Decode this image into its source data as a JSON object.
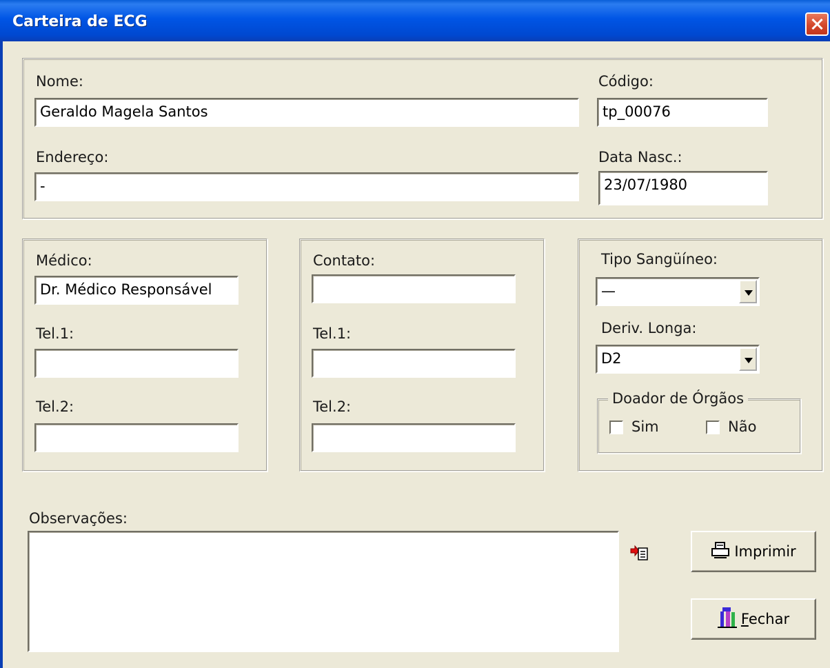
{
  "window": {
    "title": "Carteira de ECG"
  },
  "patient": {
    "name_label": "Nome:",
    "name_value": "Geraldo Magela Santos",
    "code_label": "Código:",
    "code_value": "tp_00076",
    "address_label": "Endereço:",
    "address_value": "-",
    "birth_label": "Data Nasc.:",
    "birth_value": "23/07/1980"
  },
  "doctor": {
    "label": "Médico:",
    "value": "Dr. Médico Responsável",
    "tel1_label": "Tel.1:",
    "tel1_value": "",
    "tel2_label": "Tel.2:",
    "tel2_value": ""
  },
  "contact": {
    "label": "Contato:",
    "value": "",
    "tel1_label": "Tel.1:",
    "tel1_value": "",
    "tel2_label": "Tel.2:",
    "tel2_value": ""
  },
  "medical": {
    "blood_label": "Tipo Sangüíneo:",
    "blood_value": "—",
    "lead_label": "Deriv. Longa:",
    "lead_value": "D2",
    "donor_legend": "Doador de Órgãos",
    "donor_yes": "Sim",
    "donor_no": "Não"
  },
  "notes": {
    "label": "Observações:",
    "value": ""
  },
  "buttons": {
    "print": "Imprimir",
    "close_first": "F",
    "close_rest": "echar"
  },
  "icons": {
    "import": "import-notes-icon",
    "printer": "printer-icon",
    "exit": "exit-door-icon"
  }
}
